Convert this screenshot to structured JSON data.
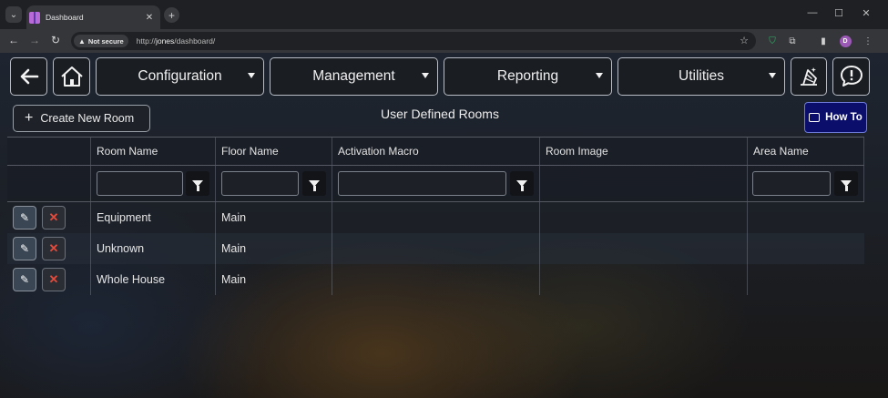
{
  "browser": {
    "tab_title": "Dashboard",
    "security_label": "Not secure",
    "url_prefix": "http://",
    "url_host": "jones",
    "url_path": "/dashboard/",
    "profile_initial": "D"
  },
  "nav": {
    "menus": [
      {
        "label": "Configuration"
      },
      {
        "label": "Management"
      },
      {
        "label": "Reporting"
      },
      {
        "label": "Utilities"
      }
    ]
  },
  "header": {
    "create_label": "Create New Room",
    "title": "User Defined Rooms",
    "howto_label": "How To"
  },
  "grid": {
    "columns": [
      "Room Name",
      "Floor Name",
      "Activation Macro",
      "Room Image",
      "Area Name"
    ],
    "rows": [
      {
        "room": "Equipment",
        "floor": "Main",
        "macro": "",
        "image": "",
        "area": ""
      },
      {
        "room": "Unknown",
        "floor": "Main",
        "macro": "",
        "image": "",
        "area": ""
      },
      {
        "room": "Whole House",
        "floor": "Main",
        "macro": "",
        "image": "",
        "area": ""
      }
    ]
  },
  "colors": {
    "howto_bg": "#0b0e6b",
    "delete_icon": "#e64a3b",
    "profile": "#9b59b6"
  }
}
